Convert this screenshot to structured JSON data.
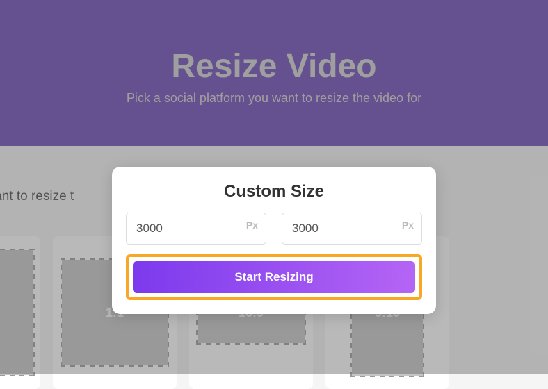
{
  "header": {
    "title": "Resize Video",
    "subtitle": "Pick a social platform you want to resize the video for"
  },
  "background": {
    "partial_text": "ou want to resize t",
    "presets": [
      {
        "label": ""
      },
      {
        "label": "1:1"
      },
      {
        "label": "16:9"
      },
      {
        "label": "9:16"
      }
    ]
  },
  "modal": {
    "title": "Custom Size",
    "width_value": "3000",
    "height_value": "3000",
    "unit_label": "Px",
    "button_label": "Start Resizing"
  }
}
